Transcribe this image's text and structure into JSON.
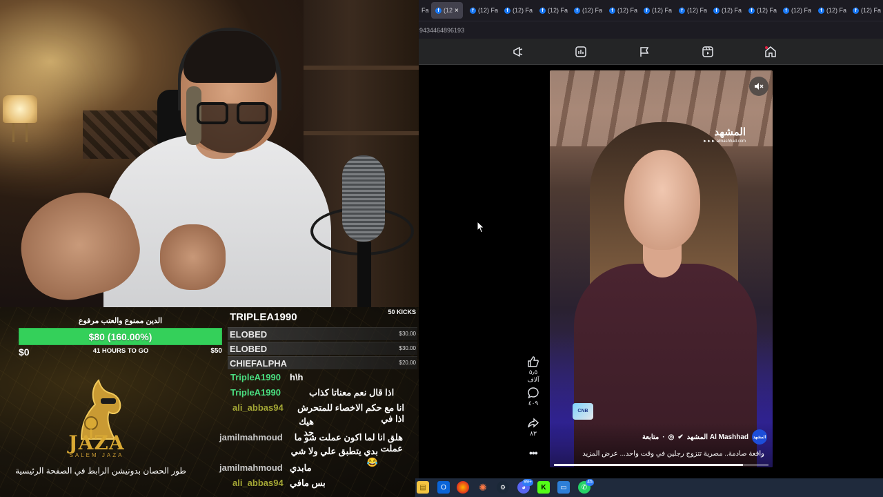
{
  "donation_goal": {
    "title": "الدين ممنوع والعتب مرفوع",
    "progress_label": "$80 (160.00%)",
    "progress_fraction": 1.0,
    "min_label": "$0",
    "remaining_label": "41 HOURS TO GO",
    "max_label": "$50"
  },
  "branding": {
    "logo_name": "JAZA",
    "logo_sub": "SALEM JAZA",
    "promo_text": "طور الحصان بدونيشن الرابط في الصفحة الرئيسية"
  },
  "leaderboard": {
    "top": {
      "name": "TRIPLEA1990",
      "amount": "50 KICKS"
    },
    "rows": [
      {
        "name": "ELOBED",
        "amount": "$30.00"
      },
      {
        "name": "ELOBED",
        "amount": "$30.00"
      },
      {
        "name": "CHIEFALPHA",
        "amount": "$20.00"
      }
    ]
  },
  "chat": {
    "messages": [
      {
        "user": "TripleA1990",
        "text": "h\\h",
        "color": "#4ade80"
      },
      {
        "user": "TripleA1990",
        "text": "اذا قال نعم معناتا كذاب",
        "color": "#4ade80"
      },
      {
        "user": "ali_abbas94",
        "text": "انا مع حكم الاخصاء للمتحرش اذا في",
        "text2": "هيك حد",
        "color": "#a3a635"
      },
      {
        "user": "jamilmahmoud",
        "text": "هلق انا لما اكون عملت شو ما عملت",
        "text2": "بدي يتطبق علي ولا شي 😂",
        "color": "#c9c9c9"
      },
      {
        "user": "jamilmahmoud",
        "text": "مابدي",
        "color": "#c9c9c9"
      },
      {
        "user": "ali_abbas94",
        "text": "بس مافي",
        "color": "#a3a635"
      }
    ]
  },
  "browser": {
    "tabs": [
      {
        "label": "Fa",
        "icon": "firefox-tab-partial"
      },
      {
        "label": "(12",
        "icon": "facebook-icon",
        "active": true
      },
      {
        "label": "(12) Fa",
        "icon": "facebook-icon"
      },
      {
        "label": "(12) Fa",
        "icon": "facebook-icon"
      },
      {
        "label": "(12) Fa",
        "icon": "facebook-icon"
      },
      {
        "label": "(12) Fa",
        "icon": "facebook-icon"
      },
      {
        "label": "(12) Fa",
        "icon": "facebook-icon"
      },
      {
        "label": "(12) Fa",
        "icon": "facebook-icon"
      },
      {
        "label": "(12) Fa",
        "icon": "facebook-icon"
      },
      {
        "label": "(12) Fa",
        "icon": "facebook-icon"
      },
      {
        "label": "(12) Fa",
        "icon": "facebook-icon"
      },
      {
        "label": "(12) Fa",
        "icon": "facebook-icon"
      },
      {
        "label": "(12) Fa",
        "icon": "facebook-icon"
      },
      {
        "label": "(12) Fa",
        "icon": "facebook-icon"
      }
    ],
    "url_text": "9434464896193",
    "nav_icons": [
      "megaphone-icon",
      "dashboard-icon",
      "flag-icon",
      "reels-icon",
      "home-icon"
    ]
  },
  "reel": {
    "brand": "المشهد",
    "brand_sub": "►►► almashhad.com",
    "badge_text": "CNB",
    "page_name": "Al Mashhad المشهد",
    "page_avatar_text": "المشهد",
    "follow_label": "متابعة",
    "caption": "واقعة صادمة.. مصرية تتزوج رجلين في وقت واحد... عرض المزيد",
    "progress_fraction": 0.88,
    "likes_count": "٥٫٥ آلاف",
    "comments_count": "٤٠٩",
    "shares_count": "٨٣"
  },
  "taskbar": {
    "icons": [
      "file-explorer-icon",
      "outlook-icon",
      "firefox-icon",
      "sparkle-app-icon",
      "steam-icon",
      "discord-icon",
      "kick-icon",
      "window-icon",
      "whatsapp-icon"
    ],
    "discord_badge": "99+",
    "whatsapp_badge": "45"
  },
  "colors": {
    "goal_bar": "#34d05a",
    "facebook_blue": "#1877f2",
    "logo_gold": "#d9a934"
  }
}
